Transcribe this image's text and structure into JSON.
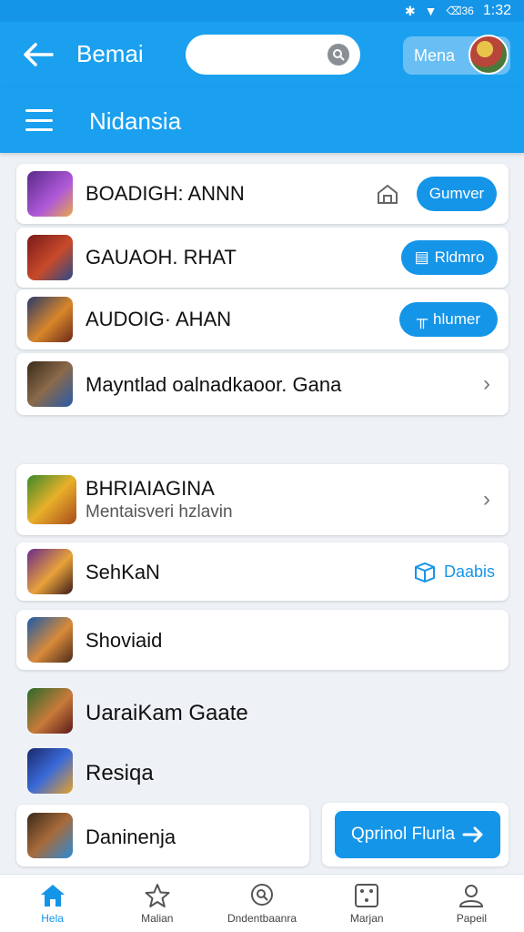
{
  "status_bar": {
    "signal_text": "⌫36",
    "time": "1:32"
  },
  "header": {
    "title": "Bemai",
    "search_placeholder": "",
    "menu_label": "Mena"
  },
  "subheader": {
    "title": "Nidansia"
  },
  "list": [
    {
      "title": "BOADIGH: ANNN",
      "action": "Gumver"
    },
    {
      "title": "GAUAOH. RHAT",
      "action": "Rldmro"
    },
    {
      "title": "AUDOIG· AHAN",
      "action": "hlumer"
    },
    {
      "title": "Mayntlad oalnadkaoor. Gana"
    },
    {
      "title": "BHRIAIAGINA",
      "subtitle": "Mentaisveri hzlavin"
    },
    {
      "title": "SehKaN",
      "action": "Daabis"
    },
    {
      "title": "Shoviaid"
    },
    {
      "title": "UaraiKam Gaate"
    },
    {
      "title": "Resiqa"
    },
    {
      "title": "Daninenja"
    }
  ],
  "optional_button": {
    "label": "Qprinol Flurla"
  },
  "bottom_nav": [
    {
      "label": "Hela",
      "icon": "home-icon",
      "active": true
    },
    {
      "label": "Malian",
      "icon": "star-icon"
    },
    {
      "label": "Dndentbaanra",
      "icon": "search-circle-icon"
    },
    {
      "label": "Marjan",
      "icon": "dice-icon"
    },
    {
      "label": "Papeil",
      "icon": "person-icon"
    }
  ],
  "colors": {
    "primary": "#1595e8",
    "header": "#1aa0ef"
  }
}
